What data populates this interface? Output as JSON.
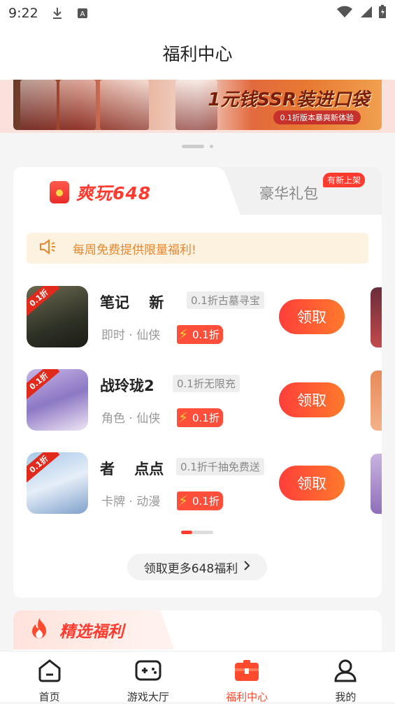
{
  "status_bar": {
    "time": "9:22"
  },
  "header": {
    "title": "福利中心"
  },
  "banner": {
    "headline": "1元钱SSR装进口袋",
    "subline": "0.1折版本暴爽新体验"
  },
  "tabs": [
    {
      "label": "爽玩648",
      "active": true
    },
    {
      "label": "豪华礼包",
      "active": false,
      "badge": "有新上架"
    }
  ],
  "notice": {
    "text": "每周免费提供限量福利!"
  },
  "games": [
    {
      "name": "笔记　 新",
      "tag": "0.1折古墓寻宝",
      "meta": "即时 · 仙侠",
      "discount": "0.1折",
      "button": "领取",
      "corner": "0.1折"
    },
    {
      "name": "战玲珑2",
      "tag": "0.1折无限充",
      "meta": "角色 · 仙侠",
      "discount": "0.1折",
      "button": "领取",
      "corner": "0.1折"
    },
    {
      "name": "者　 点点",
      "tag": "0.1折千抽免费送",
      "meta": "卡牌 · 动漫",
      "discount": "0.1折",
      "button": "领取",
      "corner": "0.1折"
    }
  ],
  "more_button": {
    "label": "领取更多648福利"
  },
  "section2": {
    "title": "精选福利"
  },
  "tabbar": [
    {
      "label": "首页",
      "active": false
    },
    {
      "label": "游戏大厅",
      "active": false
    },
    {
      "label": "福利中心",
      "active": true
    },
    {
      "label": "我的",
      "active": false
    }
  ],
  "colors": {
    "accent": "#ff3b30",
    "accent_orange": "#ff7a2b",
    "notice_text": "#e8862b"
  }
}
